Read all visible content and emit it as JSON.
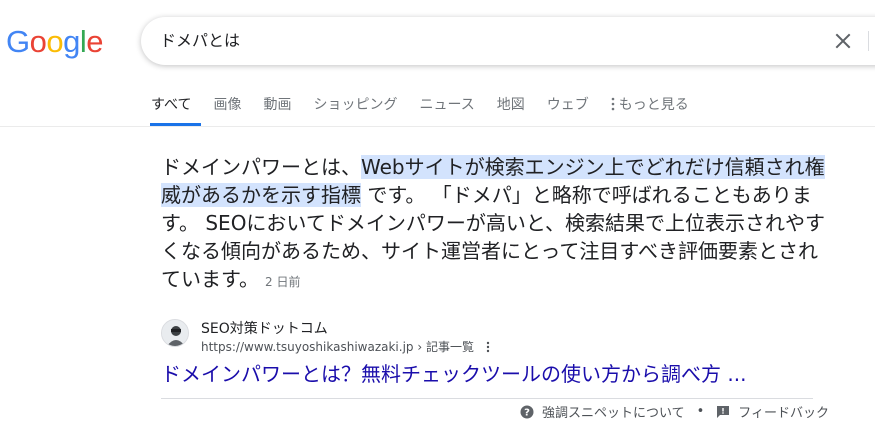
{
  "logo": {
    "letters": [
      "G",
      "o",
      "o",
      "g",
      "l",
      "e"
    ],
    "colors": [
      "#4285F4",
      "#EA4335",
      "#FBBC05",
      "#4285F4",
      "#34A853",
      "#EA4335"
    ]
  },
  "search": {
    "value": "ドメパとは"
  },
  "tabs": [
    {
      "label": "すべて"
    },
    {
      "label": "画像"
    },
    {
      "label": "動画"
    },
    {
      "label": "ショッピング"
    },
    {
      "label": "ニュース"
    },
    {
      "label": "地図"
    },
    {
      "label": "ウェブ"
    },
    {
      "label": "もっと見る"
    }
  ],
  "snippet": {
    "pre": "ドメインパワーとは、",
    "highlight1": "Webサイトが検索エンジン上でどれだけ信頼され",
    "highlight2": "権威があるかを示す指標",
    "post": " です。 「ドメパ」と略称で呼ばれることもあります。 SEOにおいてドメインパワーが高いと、検索結果で上位表示されやすくなる傾向があるため、サイト運営者にとって注目すべき評価要素とされています。",
    "date": "2 日前"
  },
  "source": {
    "name": "SEO対策ドットコム",
    "url": "https://www.tsuyoshikashiwazaki.jp",
    "breadcrumb": " › 記事一覧"
  },
  "result": {
    "title": "ドメインパワーとは？無料チェックツールの使い方から調べ方 ..."
  },
  "footer": {
    "about": "強調スニペットについて",
    "separator": "•",
    "feedback": "フィードバック"
  },
  "colors": {
    "accent": "#1a73e8",
    "link": "#1a0dab",
    "highlight": "#d3e3fd"
  }
}
